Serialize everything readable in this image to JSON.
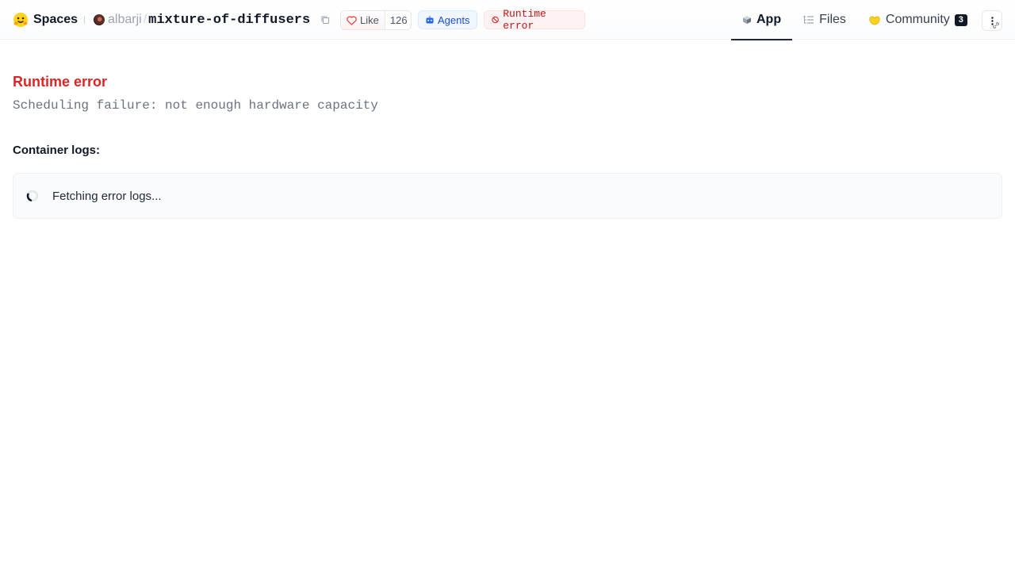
{
  "header": {
    "brand_label": "Spaces",
    "owner": "albarji",
    "separator": "/",
    "repo_name": "mixture-of-diffusers",
    "like_label": "Like",
    "like_count": "126",
    "agents_label": "Agents",
    "status_label": "Runtime error",
    "tabs": [
      {
        "label": "App",
        "active": true
      },
      {
        "label": "Files",
        "active": false
      },
      {
        "label": "Community",
        "active": false,
        "badge": "3"
      }
    ]
  },
  "main": {
    "error_title": "Runtime error",
    "error_message": "Scheduling failure: not enough hardware capacity",
    "logs_heading": "Container logs:",
    "logs_status": "Fetching error logs..."
  },
  "colors": {
    "error_red": "#dc2626",
    "agents_blue": "#1d4ed8",
    "accent_dark": "#1f2937"
  },
  "icons": {
    "brand": "hugging-face-icon",
    "copy": "copy-icon",
    "like": "heart-icon",
    "agents": "robot-icon",
    "status": "stop-circle-icon",
    "app_tab": "cube-icon",
    "files_tab": "file-tree-icon",
    "community_tab": "hands-icon",
    "more": "vertical-dots-icon",
    "loading": "spinner-icon"
  }
}
